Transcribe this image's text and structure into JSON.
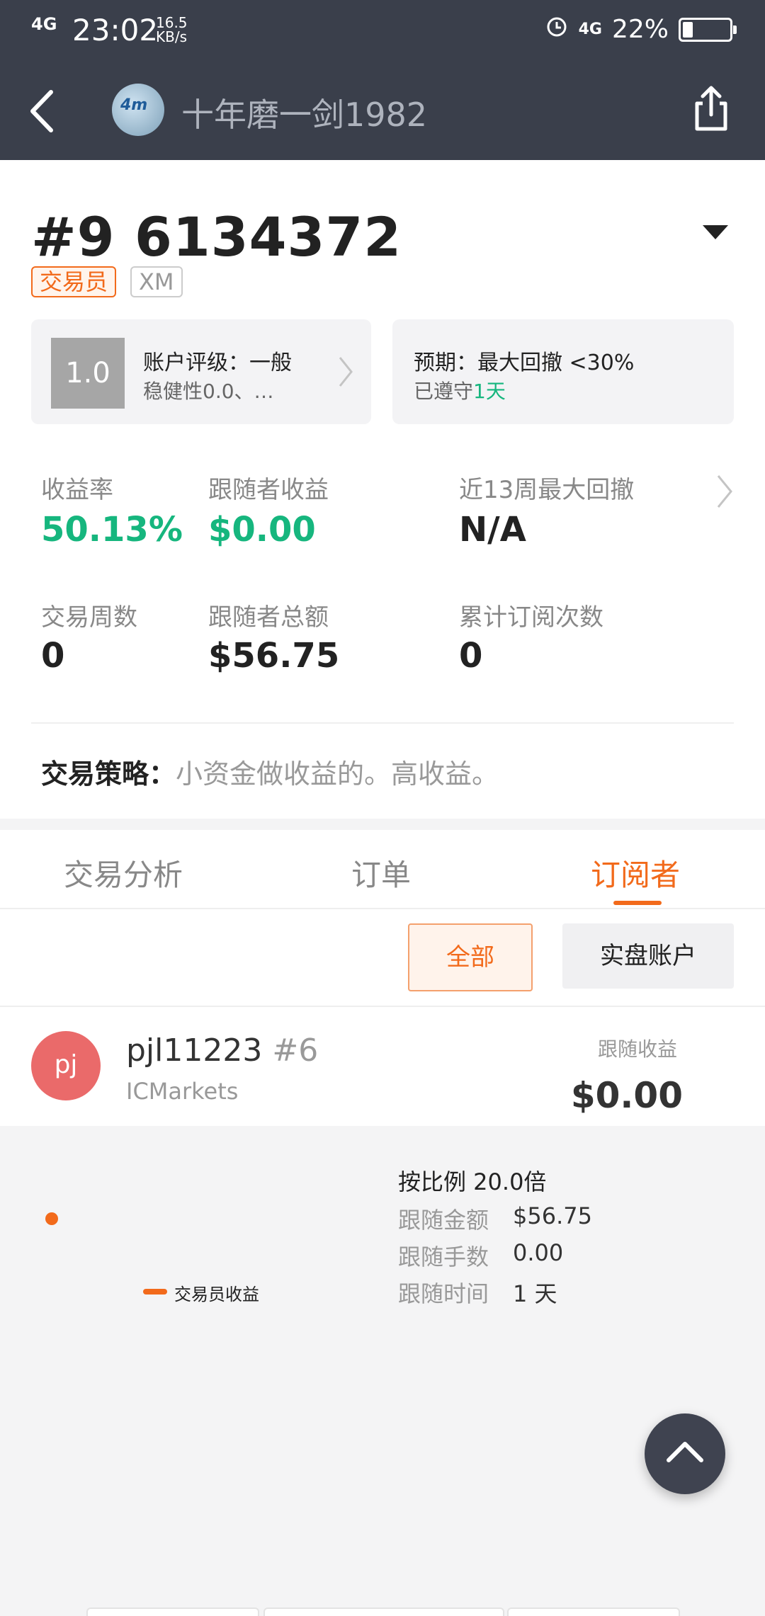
{
  "status_bar": {
    "signal": "4G",
    "time": "23:02",
    "speed": "16.5",
    "speed_unit": "KB/s",
    "network_right": "4G",
    "battery": "22%"
  },
  "header": {
    "avatar_text": "4m",
    "title": "十年磨一剑1982"
  },
  "account": {
    "number": "#9 6134372",
    "tag_trader": "交易员",
    "tag_broker": "XM"
  },
  "rating_box": {
    "score": "1.0",
    "title": "账户评级：一般",
    "subtitle": "稳健性0.0、…"
  },
  "expect_box": {
    "title": "预期：最大回撤 <30%",
    "complied_prefix": "已遵守",
    "complied_value": "1天"
  },
  "stats": {
    "yield_label": "收益率",
    "yield_value": "50.13%",
    "follower_profit_label": "跟随者收益",
    "follower_profit_value": "$0.00",
    "drawdown_label": "近13周最大回撤",
    "drawdown_value": "N/A",
    "weeks_label": "交易周数",
    "weeks_value": "0",
    "follower_total_label": "跟随者总额",
    "follower_total_value": "$56.75",
    "subs_label": "累计订阅次数",
    "subs_value": "0"
  },
  "strategy": {
    "label": "交易策略：",
    "text": "小资金做收益的。高收益。"
  },
  "tabs": [
    {
      "label": "交易分析"
    },
    {
      "label": "订单"
    },
    {
      "label": "订阅者"
    }
  ],
  "filters": {
    "all": "全部",
    "real": "实盘账户"
  },
  "subscriber": {
    "avatar": "pj",
    "name": "pjl11223",
    "rank": "#6",
    "broker": "ICMarkets",
    "profit_label": "跟随收益",
    "profit_value": "$0.00"
  },
  "details": {
    "legend": "交易员收益",
    "ratio": "按比例 20.0倍",
    "amount_label": "跟随金额",
    "amount_value": "$56.75",
    "lots_label": "跟随手数",
    "lots_value": "0.00",
    "time_label": "跟随时间",
    "time_value": "1 天"
  },
  "colors": {
    "accent": "#f26a1b",
    "positive": "#16b67e",
    "header_bg": "#3a3f4b"
  }
}
